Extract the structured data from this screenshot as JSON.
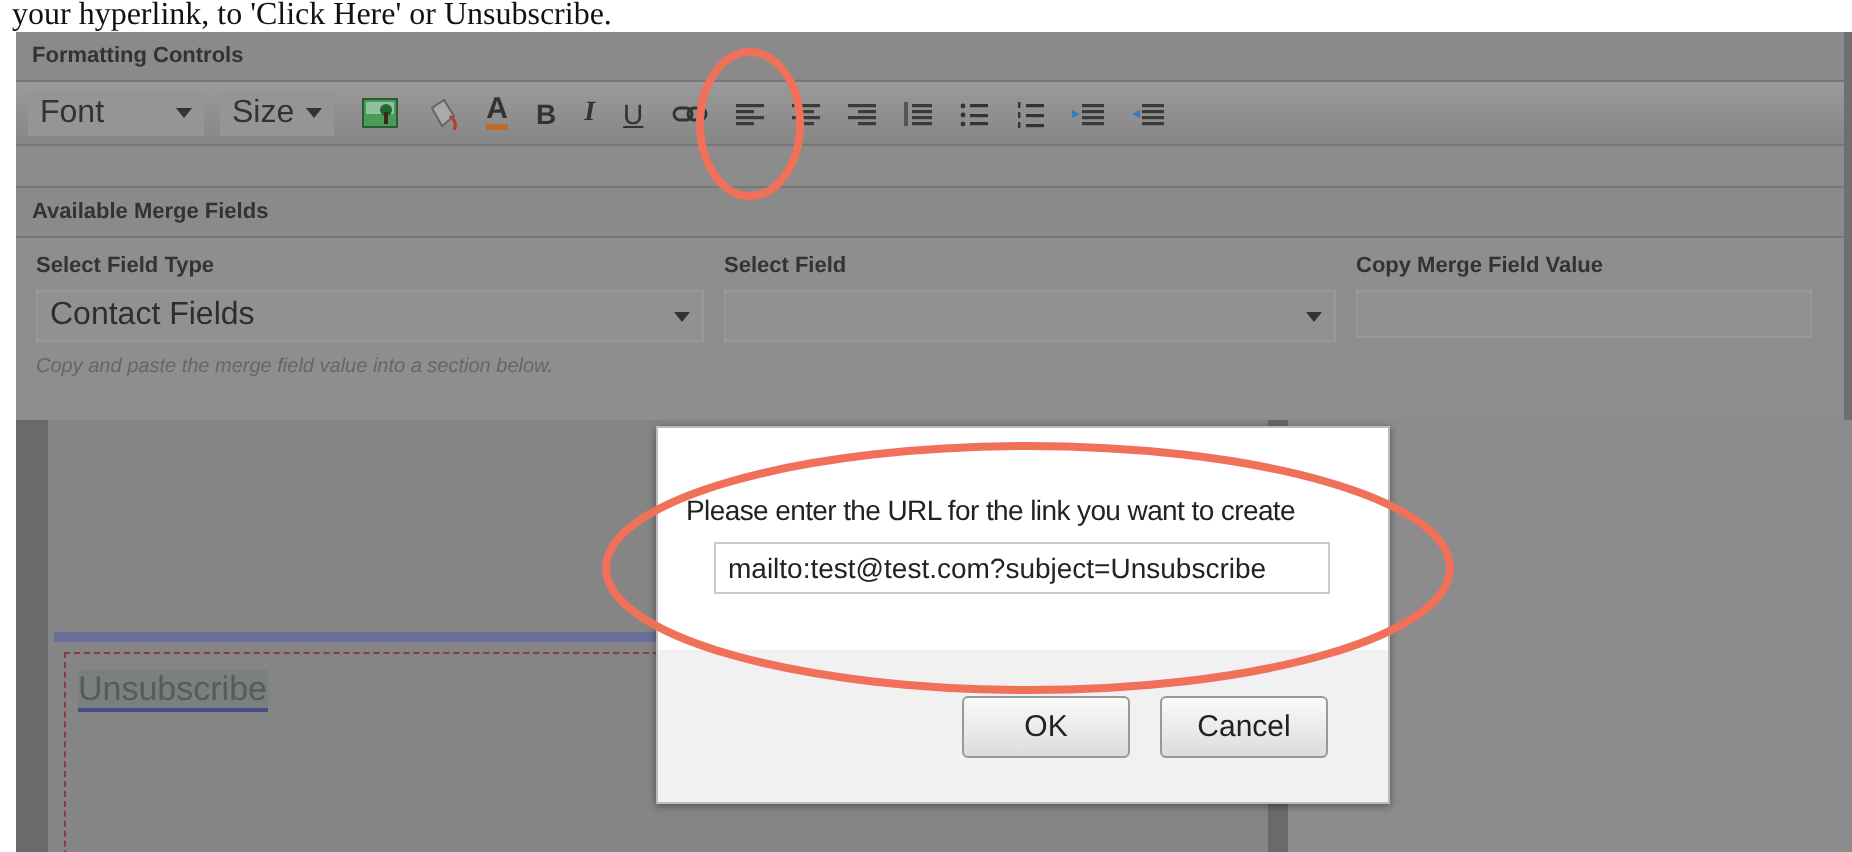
{
  "document_text": "your hyperlink, to 'Click Here' or Unsubscribe.",
  "formatting_controls": {
    "title": "Formatting Controls",
    "tools": [
      {
        "kind": "select",
        "value": "Font"
      },
      {
        "kind": "select",
        "value": "Size"
      },
      {
        "kind": "image"
      },
      {
        "kind": "paint"
      },
      {
        "kind": "color",
        "label": "A"
      },
      {
        "kind": "bold",
        "label": "B"
      },
      {
        "kind": "italic",
        "label": "I"
      },
      {
        "kind": "underline",
        "label": "U"
      },
      {
        "kind": "link"
      },
      {
        "kind": "align-left"
      },
      {
        "kind": "align-center"
      },
      {
        "kind": "align-right"
      },
      {
        "kind": "justify"
      },
      {
        "kind": "bullets"
      },
      {
        "kind": "numbers"
      },
      {
        "kind": "indent"
      },
      {
        "kind": "outdent"
      }
    ]
  },
  "merge_fields": {
    "title": "Available Merge Fields",
    "fields": [
      {
        "kind": "select",
        "label": "Select Field Type",
        "value": "Contact Fields"
      },
      {
        "kind": "select",
        "label": "Select Field"
      },
      {
        "kind": "input",
        "label": "Copy Merge Field Value"
      }
    ],
    "hint": "Copy and paste the merge field value into a section below."
  },
  "editor": {
    "selected_text": "Unsubscribe"
  },
  "dialog": {
    "prompt": "Please enter the URL for the link you want to create",
    "url_field": {
      "value": "mailto:test@test.com?subject=Unsubscribe"
    },
    "buttons": [
      {
        "label": "OK"
      },
      {
        "label": "Cancel"
      }
    ]
  }
}
